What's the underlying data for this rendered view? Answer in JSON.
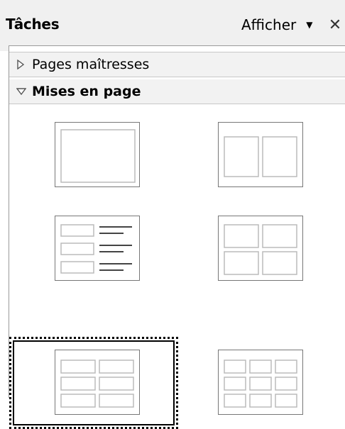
{
  "panel": {
    "title": "Tâches",
    "view_menu_label": "Afficher",
    "view_menu_icon": "caret-down-icon",
    "close_icon": "close-icon"
  },
  "sections": {
    "master_pages": {
      "label": "Pages maîtresses",
      "expanded": false
    },
    "layouts": {
      "label": "Mises en page",
      "expanded": true
    }
  },
  "layouts": [
    {
      "name": "title-content",
      "selected": false
    },
    {
      "name": "two-columns",
      "selected": false
    },
    {
      "name": "title-list",
      "selected": false
    },
    {
      "name": "four-boxes",
      "selected": false
    },
    {
      "name": "six-boxes",
      "selected": true
    },
    {
      "name": "nine-boxes",
      "selected": false
    }
  ]
}
